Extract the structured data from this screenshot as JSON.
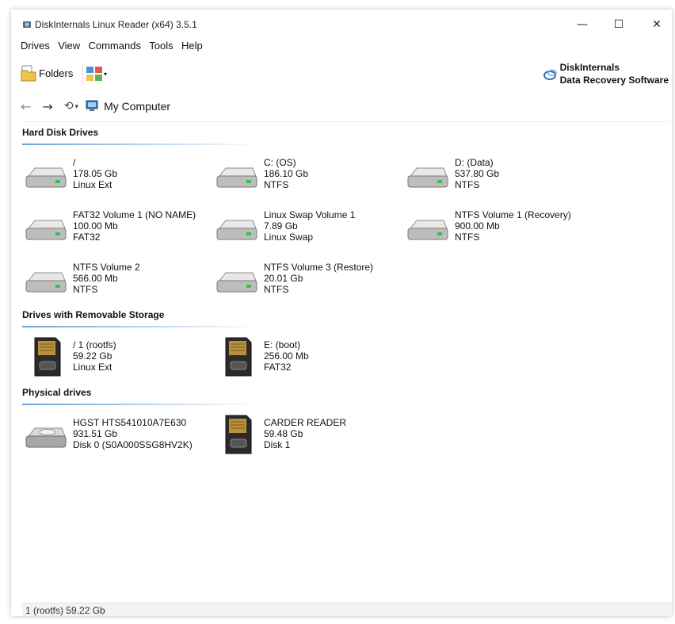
{
  "window": {
    "title": "DiskInternals Linux Reader (x64) 3.5.1",
    "minimize": "—",
    "maximize": "☐",
    "close": "✕"
  },
  "menu": [
    "Drives",
    "View",
    "Commands",
    "Tools",
    "Help"
  ],
  "toolbar": {
    "folders_label": "Folders",
    "brand_line1": "DiskInternals",
    "brand_line2": "Data Recovery Software"
  },
  "nav": {
    "back": "←",
    "forward": "→",
    "history": "⟲",
    "history_dropdown": "▾",
    "location": "My Computer"
  },
  "sections": {
    "hdd": "Hard Disk Drives",
    "removable": "Drives with Removable Storage",
    "physical": "Physical drives"
  },
  "hdd": [
    {
      "name": "/",
      "size": "178.05 Gb",
      "fs": "Linux Ext"
    },
    {
      "name": "C: (OS)",
      "size": "186.10 Gb",
      "fs": "NTFS"
    },
    {
      "name": "D: (Data)",
      "size": "537.80 Gb",
      "fs": "NTFS"
    },
    {
      "name": "FAT32 Volume 1 (NO NAME)",
      "size": "100.00 Mb",
      "fs": "FAT32"
    },
    {
      "name": "Linux Swap Volume 1",
      "size": "7.89 Gb",
      "fs": "Linux Swap"
    },
    {
      "name": "NTFS Volume 1 (Recovery)",
      "size": "900.00 Mb",
      "fs": "NTFS"
    },
    {
      "name": "NTFS Volume 2",
      "size": "566.00 Mb",
      "fs": "NTFS"
    },
    {
      "name": "NTFS Volume 3 (Restore)",
      "size": "20.01 Gb",
      "fs": "NTFS"
    }
  ],
  "removable": [
    {
      "name": "/ 1 (rootfs)",
      "size": "59.22 Gb",
      "fs": "Linux Ext"
    },
    {
      "name": "E: (boot)",
      "size": "256.00 Mb",
      "fs": "FAT32"
    }
  ],
  "physical": [
    {
      "name": "HGST HTS541010A7E630",
      "size": "931.51 Gb",
      "fs": "Disk 0 (S0A000SSG8HV2K)"
    },
    {
      "name": "CARDER READER",
      "size": "59.48 Gb",
      "fs": "Disk 1"
    }
  ],
  "status": {
    "text": "1 (rootfs) 59.22 Gb"
  },
  "colors": {
    "section_line": "#6aa3d8",
    "status_bg": "#f2f2f2"
  }
}
